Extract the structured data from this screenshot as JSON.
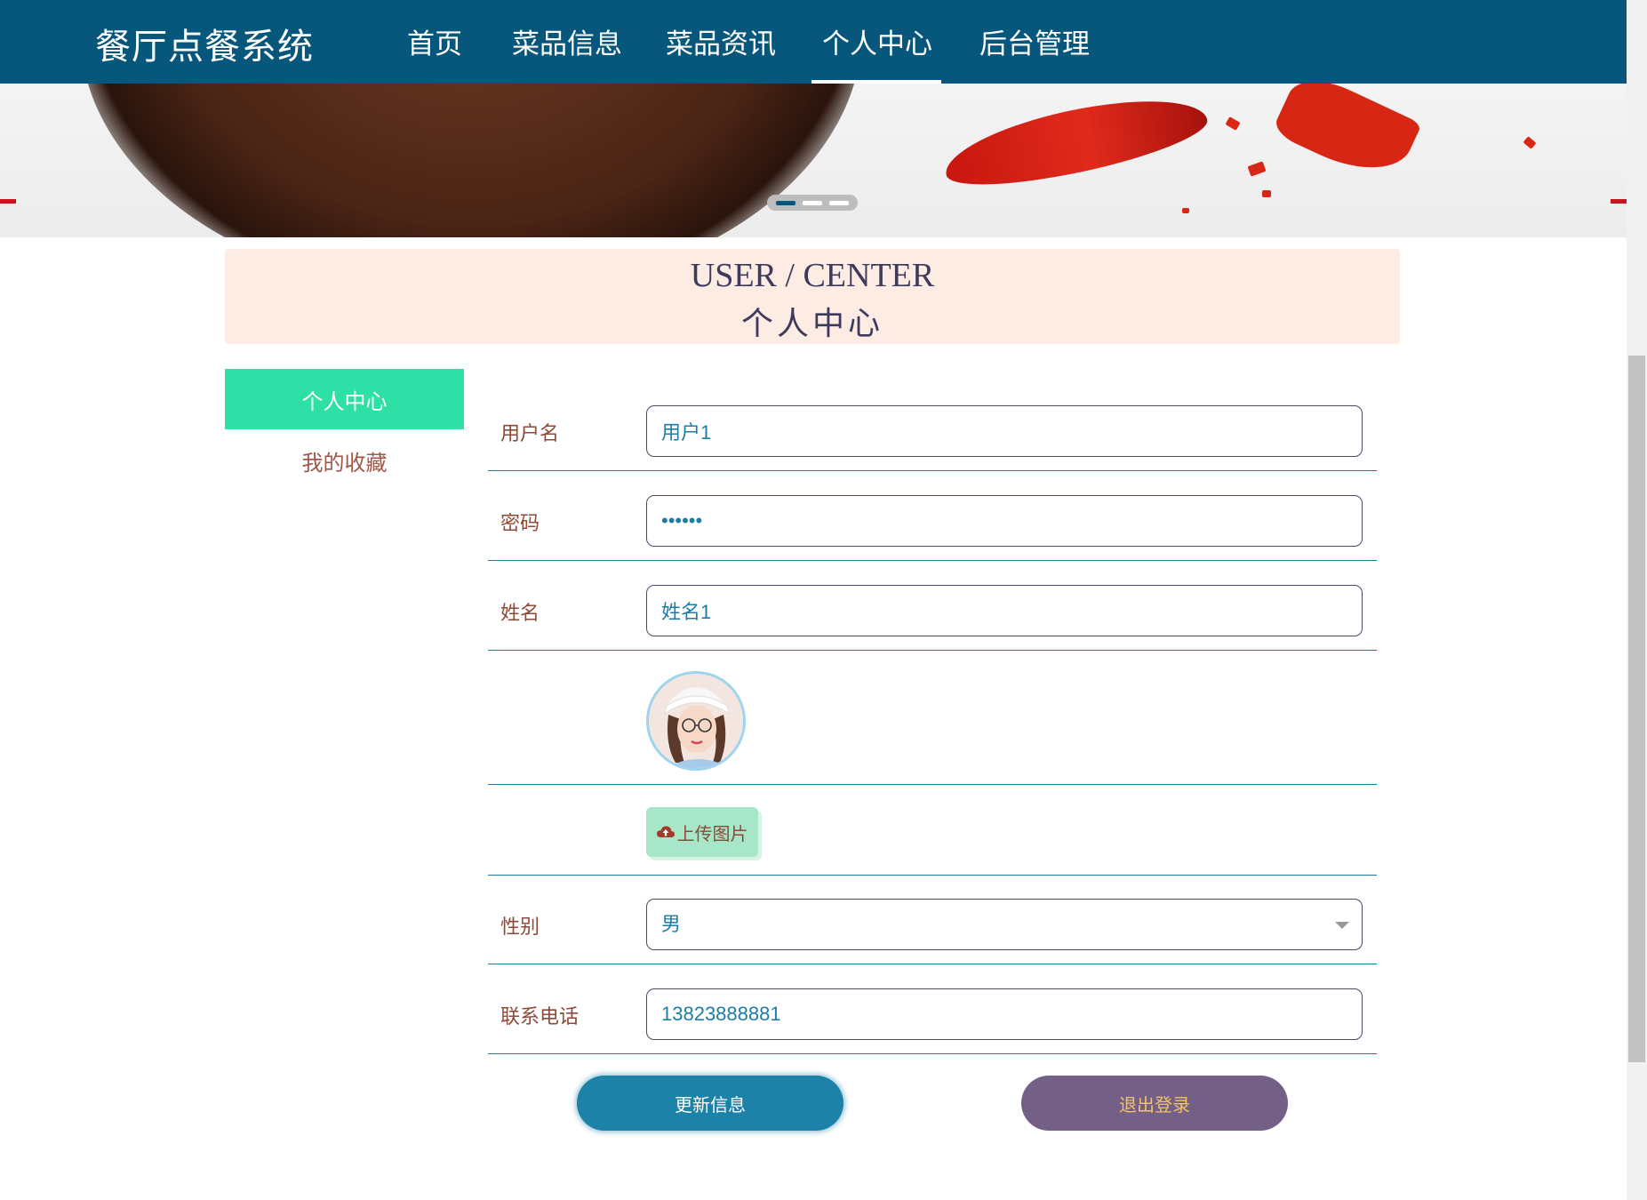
{
  "app": {
    "brand": "餐厅点餐系统"
  },
  "nav": {
    "items": [
      {
        "label": "首页"
      },
      {
        "label": "菜品信息"
      },
      {
        "label": "菜品资讯"
      },
      {
        "label": "个人中心",
        "active": true
      },
      {
        "label": "后台管理"
      }
    ]
  },
  "banner": {
    "slides": 3,
    "active_slide": 1
  },
  "title": {
    "en": "USER / CENTER",
    "cn": "个人中心"
  },
  "side_menu": {
    "items": [
      {
        "label": "个人中心",
        "active": true
      },
      {
        "label": "我的收藏"
      }
    ]
  },
  "form": {
    "username": {
      "label": "用户名",
      "value": "用户1"
    },
    "password": {
      "label": "密码",
      "value": "••••••"
    },
    "name": {
      "label": "姓名",
      "value": "姓名1"
    },
    "upload": {
      "label": "上传图片",
      "icon": "cloud-upload-icon"
    },
    "gender": {
      "label": "性别",
      "value": "男"
    },
    "phone": {
      "label": "联系电话",
      "value": "13823888881"
    }
  },
  "buttons": {
    "update": "更新信息",
    "logout": "退出登录"
  },
  "colors": {
    "nav_bg": "#07577c",
    "accent_green": "#2fe0a6",
    "title_bg": "#fcece4",
    "label_text": "#8e4a37",
    "field_text": "#1c7ea5",
    "update_btn": "#1c82a8",
    "logout_btn": "#745f86"
  }
}
